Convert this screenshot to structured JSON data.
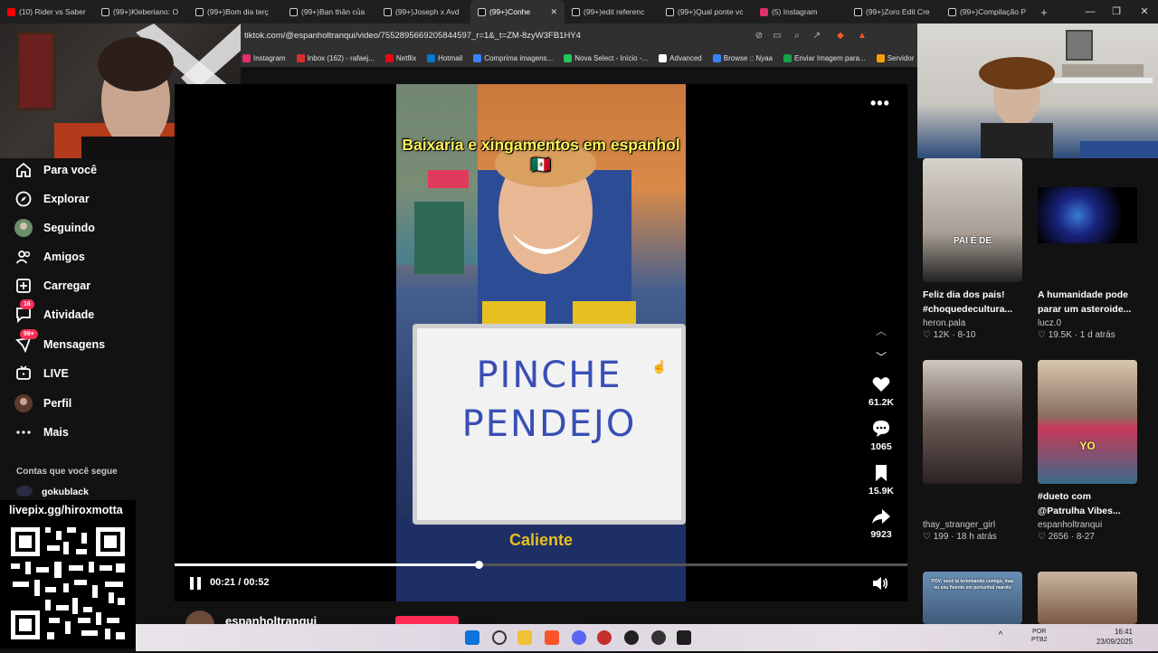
{
  "browser": {
    "tabs": [
      {
        "label": "(10) Rider vs Saber",
        "icon_color": "#ff0000",
        "active": false
      },
      {
        "label": "(99+)Kleberiano: O",
        "icon_color": "#000000",
        "active": false
      },
      {
        "label": "(99+)Bom dia terç",
        "icon_color": "#000000",
        "active": false
      },
      {
        "label": "(99+)Bạn thân của",
        "icon_color": "#000000",
        "active": false
      },
      {
        "label": "(99+)Joseph x Avd",
        "icon_color": "#000000",
        "active": false
      },
      {
        "label": "(99+)Conhe",
        "icon_color": "#000000",
        "active": true
      },
      {
        "label": "(99+)edit referenc",
        "icon_color": "#000000",
        "active": false
      },
      {
        "label": "(99+)Qual ponte vc",
        "icon_color": "#000000",
        "active": false
      },
      {
        "label": "(5) Instagram",
        "icon_color": "#e1306c",
        "active": false
      },
      {
        "label": "(99+)Zoro Edit Cre",
        "icon_color": "#000000",
        "active": false
      },
      {
        "label": "(99+)Compilação P",
        "icon_color": "#000000",
        "active": false
      }
    ],
    "new_tab": "+",
    "url": "tiktok.com/@espanholtranqui/video/7552895669205844597_r=1&_t=ZM-8zyW3FB1HY4",
    "bookmarks": [
      {
        "label": "Instagram",
        "color": "#e1306c"
      },
      {
        "label": "Inbox (162) - rafaej...",
        "color": "#d93025"
      },
      {
        "label": "Netflix",
        "color": "#e50914"
      },
      {
        "label": "Hotmail",
        "color": "#0078d4"
      },
      {
        "label": "Comprima imagens...",
        "color": "#3b82f6"
      },
      {
        "label": "Nova Select - Início -...",
        "color": "#22c55e"
      },
      {
        "label": "Advanced",
        "color": "#ffffff"
      },
      {
        "label": "Browse :: Nyaa",
        "color": "#3b82f6"
      },
      {
        "label": "Enviar Imagem para...",
        "color": "#16a34a"
      },
      {
        "label": "Servidor",
        "color": "#f59e0b"
      }
    ]
  },
  "sidebar": {
    "items": [
      {
        "label": "Para você",
        "icon": "home-icon",
        "badge": ""
      },
      {
        "label": "Explorar",
        "icon": "compass-icon",
        "badge": ""
      },
      {
        "label": "Seguindo",
        "icon": "following-avatar-icon",
        "badge": ""
      },
      {
        "label": "Amigos",
        "icon": "friends-icon",
        "badge": ""
      },
      {
        "label": "Carregar",
        "icon": "upload-icon",
        "badge": ""
      },
      {
        "label": "Atividade",
        "icon": "activity-icon",
        "badge": "16"
      },
      {
        "label": "Mensagens",
        "icon": "messages-icon",
        "badge": "99+"
      },
      {
        "label": "LIVE",
        "icon": "live-icon",
        "badge": ""
      },
      {
        "label": "Perfil",
        "icon": "profile-avatar-icon",
        "badge": ""
      },
      {
        "label": "Mais",
        "icon": "more-icon",
        "badge": ""
      }
    ],
    "following_title": "Contas que você segue",
    "following_account": "gokublack"
  },
  "overlay": {
    "qr_label": "livepix.gg/hiroxmotta"
  },
  "video": {
    "caption": "Baixaria e xingamentos em espanhol 🇲🇽",
    "board_text": "PINCHE PENDEJO",
    "current_time": "00:21",
    "duration": "00:52",
    "time_display": "00:21 / 00:52",
    "progress": 0.415,
    "author": "espanholtranqui"
  },
  "actions": [
    {
      "name": "like",
      "icon": "heart-icon",
      "count": "61.2K"
    },
    {
      "name": "comment",
      "icon": "comment-icon",
      "count": "1065"
    },
    {
      "name": "save",
      "icon": "bookmark-icon",
      "count": "15.9K"
    },
    {
      "name": "share",
      "icon": "share-icon",
      "count": "9923"
    }
  ],
  "recommendations": [
    {
      "title": "Feliz dia dos pais! #choquedecultura...",
      "author": "heron.pala",
      "likes": "12K",
      "date": "8-10",
      "thumb_text": "PAI É DE"
    },
    {
      "title": "A humanidade pode parar um asteroide...",
      "author": "lucz.0",
      "likes": "19.5K",
      "date": "1 d atrás",
      "thumb_text": ""
    },
    {
      "title": "",
      "author": "thay_stranger_girl",
      "likes": "199",
      "date": "18 h atrás",
      "thumb_text": ""
    },
    {
      "title": "#dueto com @Patrulha Vibes...",
      "author": "espanholtranqui",
      "likes": "2656",
      "date": "8-27",
      "thumb_text": "YO"
    },
    {
      "title": "",
      "author": "",
      "likes": "",
      "date": "",
      "thumb_text": "POV: você tá terminando comigo, mas eu sou fluente em portunhol maroto"
    },
    {
      "title": "",
      "author": "",
      "likes": "",
      "date": "",
      "thumb_text": ""
    }
  ],
  "taskbar": {
    "lang_top": "POR",
    "lang_bottom": "PTB2",
    "time": "16:41",
    "date": "23/09/2025"
  },
  "colors": {
    "accent": "#fe2c55",
    "background": "#121212",
    "caption": "#fff25a"
  }
}
